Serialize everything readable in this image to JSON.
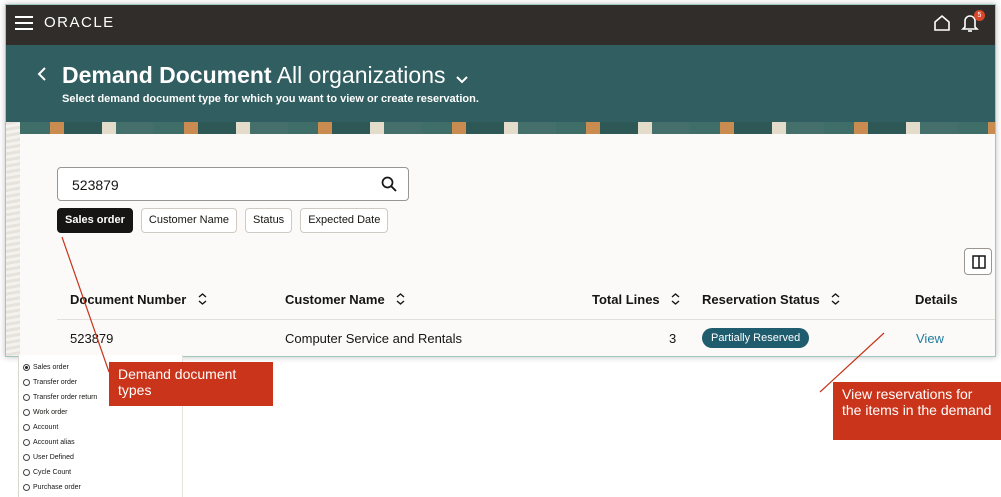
{
  "app": {
    "logo_text": "ORACLE",
    "notification_count": "5",
    "icons": [
      "hamburger-menu-icon",
      "home-icon",
      "bell-icon",
      "back-arrow-icon",
      "chevron-down-icon",
      "search-icon",
      "sort-icon",
      "columns-icon"
    ]
  },
  "page": {
    "title_bold": "Demand Document",
    "title_rest": "All organizations",
    "subtitle": "Select demand document type for which you want to view or create reservation."
  },
  "search": {
    "value": "523879"
  },
  "filters": {
    "chips": [
      "Sales order",
      "Customer Name",
      "Status",
      "Expected Date"
    ],
    "active": "Sales order"
  },
  "table": {
    "headers": {
      "document_number": "Document Number",
      "customer_name": "Customer Name",
      "total_lines": "Total Lines",
      "reservation_status": "Reservation Status",
      "details": "Details"
    },
    "rows": [
      {
        "document_number": "523879",
        "customer_name": "Computer Service and Rentals",
        "total_lines": "3",
        "reservation_status": "Partially Reserved",
        "details": "View"
      }
    ]
  },
  "document_types": {
    "options": [
      "Sales order",
      "Transfer order",
      "Transfer order return",
      "Work order",
      "Account",
      "Account alias",
      "User Defined",
      "Cycle Count",
      "Purchase order"
    ],
    "selected": "Sales order"
  },
  "callouts": {
    "demand_types": "Demand document types",
    "view_reservations": "View reservations for the items in the demand"
  },
  "colors": {
    "topbar": "#312d2a",
    "header": "#315e60",
    "status_pill": "#1f5c6e",
    "link": "#227e9e",
    "callout": "#c9341a"
  }
}
